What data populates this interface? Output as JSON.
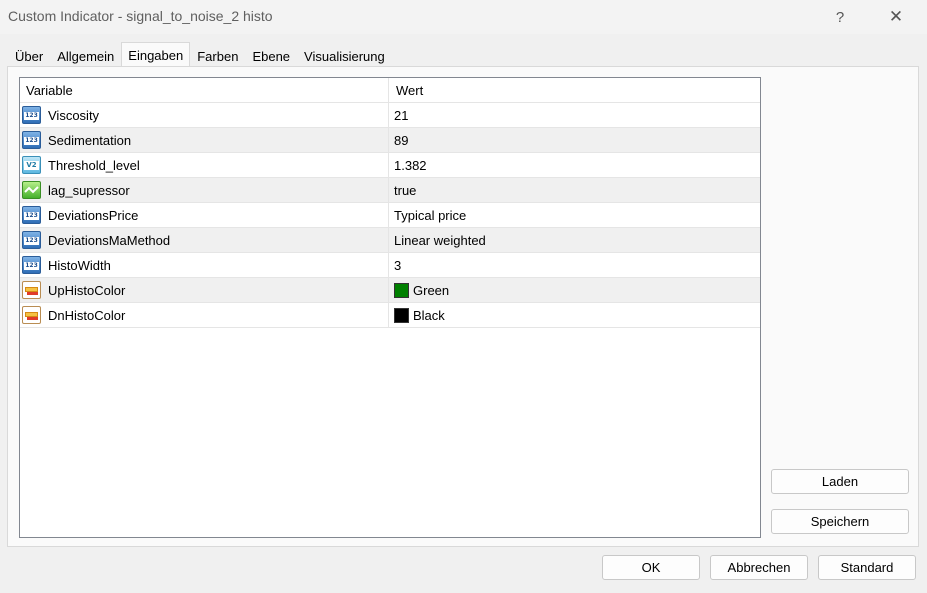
{
  "window": {
    "title": "Custom Indicator - signal_to_noise_2 histo",
    "help_glyph": "?",
    "close_glyph": "✕"
  },
  "tabs": [
    {
      "label": "Über"
    },
    {
      "label": "Allgemein"
    },
    {
      "label": "Eingaben",
      "active": true
    },
    {
      "label": "Farben"
    },
    {
      "label": "Ebene"
    },
    {
      "label": "Visualisierung"
    }
  ],
  "grid": {
    "columns": {
      "variable": "Variable",
      "value": "Wert"
    },
    "rows": [
      {
        "icon": "integer-icon",
        "icon_text": "123",
        "name": "Viscosity",
        "value": "21"
      },
      {
        "icon": "integer-icon",
        "icon_text": "123",
        "name": "Sedimentation",
        "value": "89"
      },
      {
        "icon": "double-icon",
        "icon_text": "V2",
        "name": "Threshold_level",
        "value": "1.382"
      },
      {
        "icon": "bool-icon",
        "name": "lag_supressor",
        "value": "true"
      },
      {
        "icon": "integer-icon",
        "icon_text": "123",
        "name": "DeviationsPrice",
        "value": "Typical price"
      },
      {
        "icon": "integer-icon",
        "icon_text": "123",
        "name": "DeviationsMaMethod",
        "value": "Linear weighted"
      },
      {
        "icon": "integer-icon",
        "icon_text": "123",
        "name": "HistoWidth",
        "value": "3"
      },
      {
        "icon": "color-icon",
        "name": "UpHistoColor",
        "value": "Green",
        "color": "#008000"
      },
      {
        "icon": "color-icon",
        "name": "DnHistoColor",
        "value": "Black",
        "color": "#000000"
      }
    ]
  },
  "buttons": {
    "load": "Laden",
    "save": "Speichern",
    "ok": "OK",
    "cancel": "Abbrechen",
    "default": "Standard"
  }
}
